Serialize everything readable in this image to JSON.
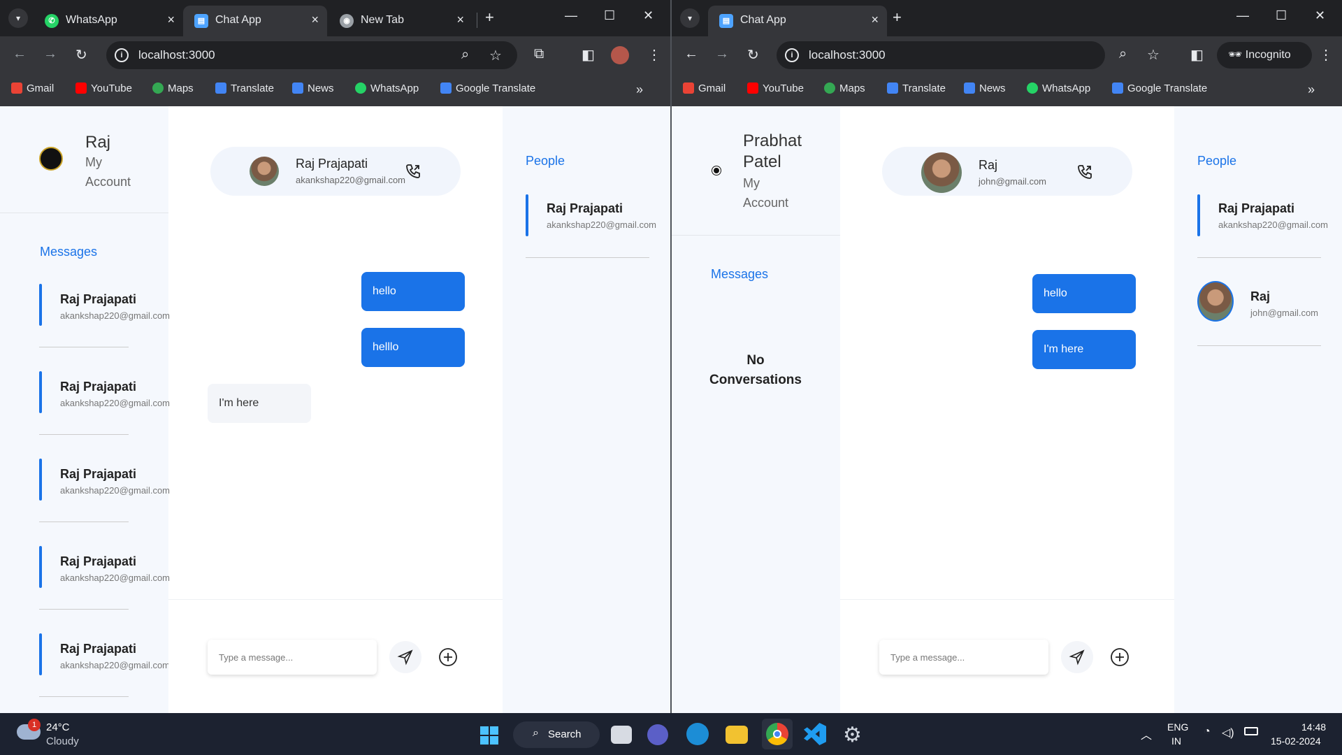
{
  "left_window": {
    "tabs": [
      {
        "title": "WhatsApp",
        "icon": "whatsapp-icon"
      },
      {
        "title": "Chat App",
        "icon": "chat-app-icon",
        "active": true
      },
      {
        "title": "New Tab",
        "icon": "chrome-icon"
      }
    ],
    "url": "localhost:3000",
    "bookmarks": [
      "Gmail",
      "YouTube",
      "Maps",
      "Translate",
      "News",
      "WhatsApp",
      "Google Translate"
    ],
    "account": {
      "name": "Raj",
      "sub1": "My",
      "sub2": "Account"
    },
    "messages_heading": "Messages",
    "conversations": [
      {
        "name": "Raj Prajapati",
        "email": "akankshap220@gmail.com"
      },
      {
        "name": "Raj Prajapati",
        "email": "akankshap220@gmail.com"
      },
      {
        "name": "Raj Prajapati",
        "email": "akankshap220@gmail.com"
      },
      {
        "name": "Raj Prajapati",
        "email": "akankshap220@gmail.com"
      },
      {
        "name": "Raj Prajapati",
        "email": "akankshap220@gmail.com"
      }
    ],
    "chat_header": {
      "name": "Raj Prajapati",
      "email": "akankshap220@gmail.com"
    },
    "bubbles": [
      {
        "text": "hello",
        "direction": "out"
      },
      {
        "text": "helllo",
        "direction": "out"
      },
      {
        "text": "I'm here",
        "direction": "in"
      }
    ],
    "composer": {
      "placeholder": "Type a message..."
    },
    "people_heading": "People",
    "people": [
      {
        "name": "Raj Prajapati",
        "email": "akankshap220@gmail.com"
      }
    ]
  },
  "right_window": {
    "tabs": [
      {
        "title": "Chat App",
        "icon": "chat-app-icon",
        "active": true
      }
    ],
    "url": "localhost:3000",
    "incognito_label": "Incognito",
    "bookmarks": [
      "Gmail",
      "YouTube",
      "Maps",
      "Translate",
      "News",
      "WhatsApp",
      "Google Translate"
    ],
    "account": {
      "name1": "Prabhat",
      "name2": "Patel",
      "sub1": "My",
      "sub2": "Account"
    },
    "messages_heading": "Messages",
    "no_conversations_1": "No",
    "no_conversations_2": "Conversations",
    "chat_header": {
      "name": "Raj",
      "email": "john@gmail.com"
    },
    "bubbles": [
      {
        "text": "hello",
        "direction": "out"
      },
      {
        "text": "I'm here",
        "direction": "out"
      }
    ],
    "composer": {
      "placeholder": "Type a message..."
    },
    "people_heading": "People",
    "people": [
      {
        "name": "Raj Prajapati",
        "email": "akankshap220@gmail.com"
      },
      {
        "name": "Raj",
        "email": "john@gmail.com"
      }
    ]
  },
  "taskbar": {
    "weather_badge": "1",
    "temperature": "24°C",
    "condition": "Cloudy",
    "search_label": "Search",
    "lang1": "ENG",
    "lang2": "IN",
    "time": "14:48",
    "date": "15-02-2024"
  },
  "colors": {
    "accent": "#1a73e8",
    "chrome_dark": "#202124",
    "chrome_toolbar": "#35363a",
    "sidebar_bg": "#f5f8fd"
  }
}
